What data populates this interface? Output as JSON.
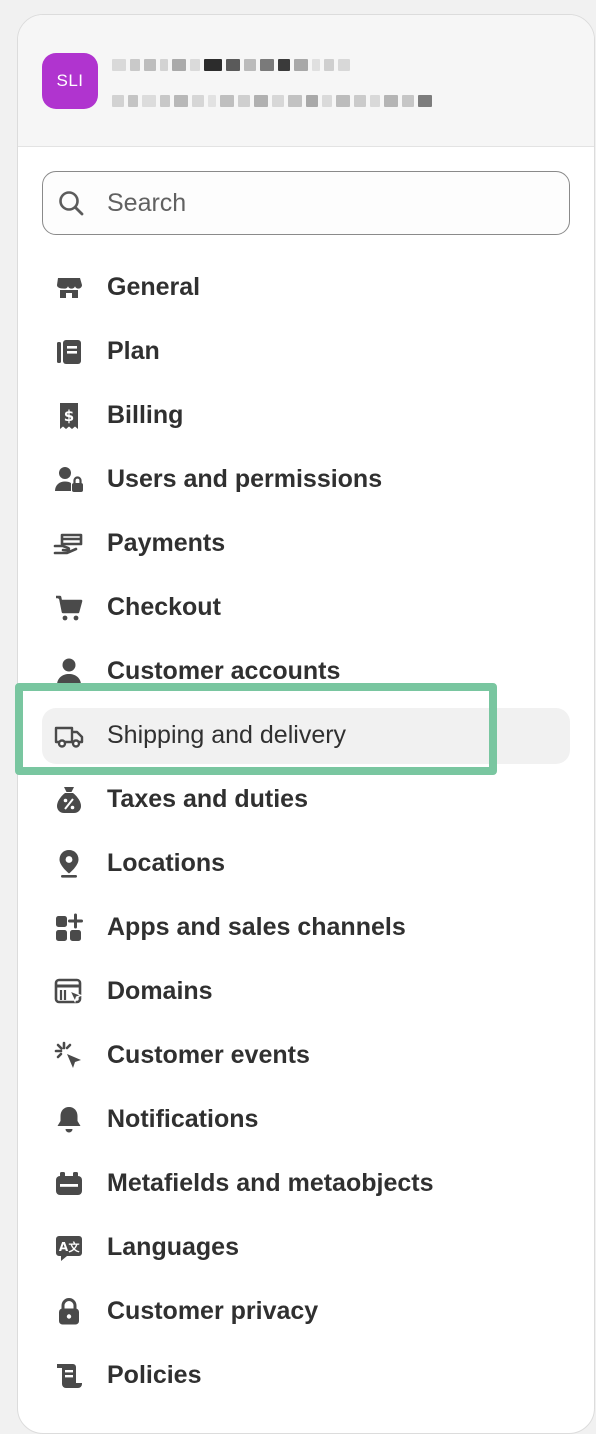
{
  "store": {
    "avatar_initials": "SLI"
  },
  "search": {
    "placeholder": "Search"
  },
  "nav": {
    "items": [
      {
        "label": "General",
        "icon": "store-icon"
      },
      {
        "label": "Plan",
        "icon": "plan-icon"
      },
      {
        "label": "Billing",
        "icon": "billing-icon"
      },
      {
        "label": "Users and permissions",
        "icon": "users-icon"
      },
      {
        "label": "Payments",
        "icon": "payments-icon"
      },
      {
        "label": "Checkout",
        "icon": "cart-icon"
      },
      {
        "label": "Customer accounts",
        "icon": "person-icon"
      },
      {
        "label": "Shipping and delivery",
        "icon": "truck-icon",
        "active": true
      },
      {
        "label": "Taxes and duties",
        "icon": "tax-icon"
      },
      {
        "label": "Locations",
        "icon": "location-icon"
      },
      {
        "label": "Apps and sales channels",
        "icon": "apps-icon"
      },
      {
        "label": "Domains",
        "icon": "domains-icon"
      },
      {
        "label": "Customer events",
        "icon": "cursor-click-icon"
      },
      {
        "label": "Notifications",
        "icon": "bell-icon"
      },
      {
        "label": "Metafields and metaobjects",
        "icon": "metafields-icon"
      },
      {
        "label": "Languages",
        "icon": "language-icon"
      },
      {
        "label": "Customer privacy",
        "icon": "lock-icon"
      },
      {
        "label": "Policies",
        "icon": "policies-icon"
      }
    ]
  },
  "colors": {
    "avatar": "#b034cf",
    "highlight_border": "#79c6a0",
    "active_bg": "#f1f1f1",
    "text": "#303030"
  }
}
